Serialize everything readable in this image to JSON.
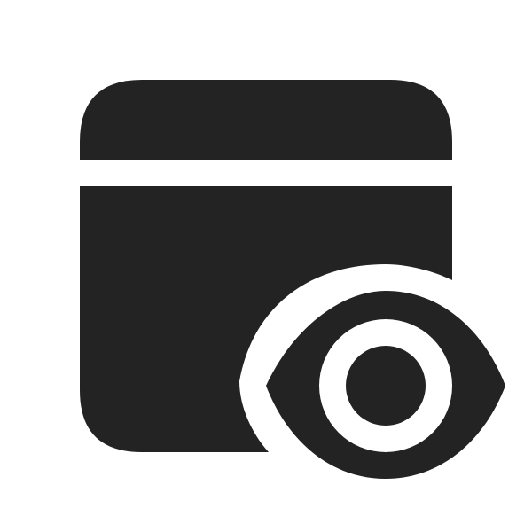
{
  "icon": {
    "name": "window-eye-icon",
    "colors": {
      "glyph": "#232323",
      "background": "#ffffff"
    }
  }
}
